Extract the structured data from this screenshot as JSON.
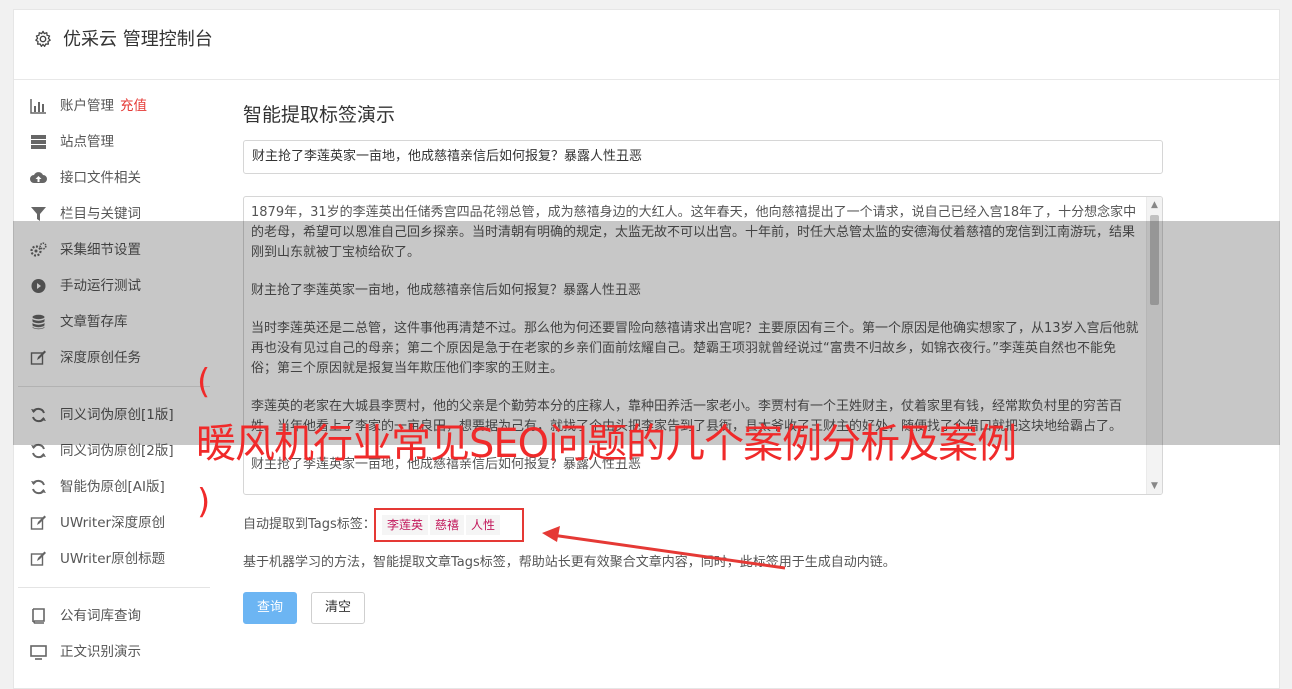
{
  "header": {
    "title": "优采云 管理控制台",
    "icon": "gear-icon"
  },
  "sidebar": {
    "group1": [
      {
        "label": "账户管理",
        "badge": "充值",
        "icon": "bar-chart-icon"
      },
      {
        "label": "站点管理",
        "icon": "server-icon"
      },
      {
        "label": "接口文件相关",
        "icon": "cloud-upload-icon"
      },
      {
        "label": "栏目与关键词",
        "icon": "filter-icon"
      },
      {
        "label": "采集细节设置",
        "icon": "cogs-icon"
      },
      {
        "label": "手动运行测试",
        "icon": "play-circle-icon"
      },
      {
        "label": "文章暂存库",
        "icon": "database-icon"
      },
      {
        "label": "深度原创任务",
        "icon": "edit-icon"
      }
    ],
    "group2": [
      {
        "label": "同义词伪原创[1版]",
        "icon": "refresh-icon"
      },
      {
        "label": "同义词伪原创[2版]",
        "icon": "refresh-icon"
      },
      {
        "label": "智能伪原创[AI版]",
        "icon": "refresh-icon"
      },
      {
        "label": "UWriter深度原创",
        "icon": "edit-icon"
      },
      {
        "label": "UWriter原创标题",
        "icon": "edit-icon"
      }
    ],
    "group3": [
      {
        "label": "公有词库查询",
        "icon": "book-icon"
      },
      {
        "label": "正文识别演示",
        "icon": "screen-icon"
      }
    ]
  },
  "main": {
    "title": "智能提取标签演示",
    "title_input_value": "财主抢了李莲英家一亩地，他成慈禧亲信后如何报复？暴露人性丑恶",
    "article_paragraphs": [
      "1879年，31岁的李莲英出任储秀宫四品花翎总管，成为慈禧身边的大红人。这年春天，他向慈禧提出了一个请求，说自己已经入宫18年了，十分想念家中的老母，希望可以恩准自己回乡探亲。当时清朝有明确的规定，太监无故不可以出宫。十年前，时任大总管太监的安德海仗着慈禧的宠信到江南游玩，结果刚到山东就被丁宝桢给砍了。",
      "财主抢了李莲英家一亩地，他成慈禧亲信后如何报复？暴露人性丑恶",
      "当时李莲英还是二总管，这件事他再清楚不过。那么他为何还要冒险向慈禧请求出宫呢？主要原因有三个。第一个原因是他确实想家了，从13岁入宫后他就再也没有见过自己的母亲；第二个原因是急于在老家的乡亲们面前炫耀自己。楚霸王项羽就曾经说过“富贵不归故乡，如锦衣夜行。”李莲英自然也不能免俗；第三个原因就是报复当年欺压他们李家的王财主。",
      "李莲英的老家在大城县李贾村，他的父亲是个勤劳本分的庄稼人，靠种田养活一家老小。李贾村有一个王姓财主，仗着家里有钱，经常欺负村里的穷苦百姓。当年他看上了李家的一亩良田，想要据为己有，就找了个由头把李家告到了县衙，县太爷收了王财主的好处，随便找了个借口就把这块地给霸占了。",
      "财主抢了李莲英家一亩地，他成慈禧亲信后如何报复？暴露人性丑恶"
    ],
    "tags_label": "自动提取到Tags标签：",
    "tags": [
      "李莲英",
      "慈禧",
      "人性"
    ],
    "description": "基于机器学习的方法，智能提取文章Tags标签，帮助站长更有效聚合文章内容，同时，此标签用于生成自动内链。",
    "query_button": "查询",
    "clear_button": "清空"
  },
  "overlay": {
    "open_paren": "(",
    "headline": "暖风机行业常见SEO问题的几个案例分析及案例",
    "close_paren": ")"
  },
  "colors": {
    "accent_blue": "#6cb5f3",
    "badge_red": "#e53935",
    "tag_text": "#c2185b",
    "overlay_red": "#f02a2a"
  }
}
